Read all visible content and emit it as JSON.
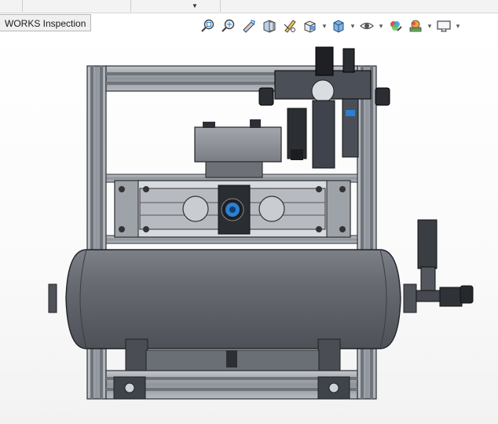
{
  "window": {
    "tab_label": "WORKS Inspection"
  },
  "toolbar": {
    "items": [
      {
        "icon": "zoom-to-fit-icon"
      },
      {
        "icon": "zoom-to-area-icon"
      },
      {
        "icon": "previous-view-icon"
      },
      {
        "icon": "section-view-icon"
      },
      {
        "icon": "dynamic-annotation-icon"
      },
      {
        "icon": "view-orientation-icon"
      },
      {
        "icon": "display-style-icon"
      },
      {
        "icon": "hide-show-items-icon"
      },
      {
        "icon": "edit-appearance-icon"
      },
      {
        "icon": "apply-scene-icon"
      },
      {
        "icon": "view-settings-icon"
      }
    ]
  },
  "colors": {
    "frame": "#9aa0a8",
    "frame_dark": "#3a3f47",
    "tank": "#5e6167",
    "tank_light": "#8a8e95",
    "accent_blue": "#2f7fd0",
    "regulator": "#4b4f58"
  }
}
